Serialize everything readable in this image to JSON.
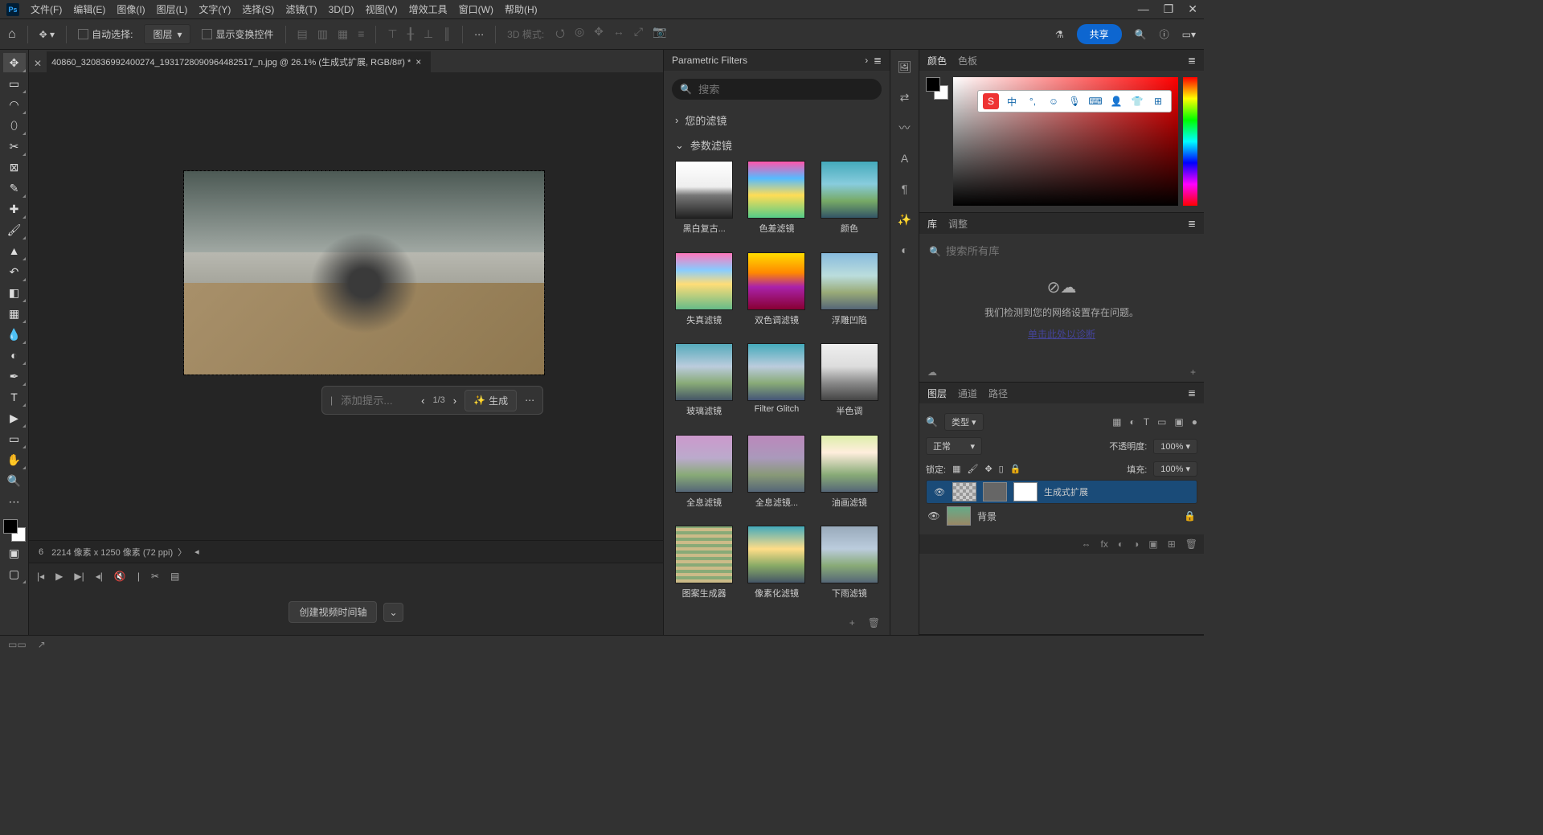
{
  "menu": {
    "items": [
      "文件(F)",
      "编辑(E)",
      "图像(I)",
      "图层(L)",
      "文字(Y)",
      "选择(S)",
      "滤镜(T)",
      "3D(D)",
      "视图(V)",
      "增效工具",
      "窗口(W)",
      "帮助(H)"
    ]
  },
  "optionbar": {
    "auto_select": "自动选择:",
    "dropdown": "图层",
    "show_transform": "显示变换控件",
    "mode_label": "3D 模式:",
    "share": "共享"
  },
  "doctab": "40860_320836992400274_1931728090964482517_n.jpg @ 26.1% (生成式扩展, RGB/8#) *",
  "gen": {
    "placeholder": "添加提示...",
    "count": "1/3",
    "button": "生成"
  },
  "status": {
    "pct": "6",
    "dims": "2214 像素 x 1250 像素 (72 ppi)"
  },
  "timeline": {
    "create": "创建视频时间轴"
  },
  "filters": {
    "title": "Parametric Filters",
    "search_ph": "搜索",
    "your": "您的滤镜",
    "param": "参数滤镜",
    "items": [
      {
        "label": "黑白复古...",
        "g": "linear-gradient(180deg,#fff 0%,#eee 45%,#777 60%,#222 100%)"
      },
      {
        "label": "色差滤镜",
        "g": "linear-gradient(180deg,#f5a 0%,#5bf 30%,#fd5 60%,#5c8 100%)"
      },
      {
        "label": "颜色",
        "g": "linear-gradient(180deg,#4ab 0%,#8cd 40%,#7a6 70%,#356 100%)"
      },
      {
        "label": "失真滤镜",
        "g": "linear-gradient(180deg,#f7b 0%,#8cf 30%,#fd7 55%,#6b8 100%)"
      },
      {
        "label": "双色调滤镜",
        "g": "linear-gradient(180deg,#fd0 0%,#f80 35%,#a2a 60%,#803 100%)"
      },
      {
        "label": "浮雕凹陷",
        "g": "linear-gradient(180deg,#8bd 0%,#bdd 40%,#9a7 70%,#567 100%)"
      },
      {
        "label": "玻璃滤镜",
        "g": "linear-gradient(180deg,#5ab 0%,#bcd 40%,#8a7 70%,#456 100%)"
      },
      {
        "label": "Filter Glitch",
        "g": "linear-gradient(180deg,#4ab 0%,#bcd 40%,#8a7 70%,#457 100%)"
      },
      {
        "label": "半色调",
        "g": "linear-gradient(180deg,#eee 0%,#ddd 40%,#888 70%,#444 100%)"
      },
      {
        "label": "全息滤镜",
        "g": "linear-gradient(180deg,#c9c 0%,#bac 40%,#8a7 70%,#567 100%)"
      },
      {
        "label": "全息滤镜...",
        "g": "linear-gradient(180deg,#b8b 0%,#a9b 40%,#897 70%,#567 100%)"
      },
      {
        "label": "油画滤镜",
        "g": "linear-gradient(180deg,#dea 0%,#fed 30%,#8a7 70%,#567 100%)"
      },
      {
        "label": "图案生成器",
        "g": "repeating-linear-gradient(0deg,#cb8 0 4px,#8a7 4px 8px),repeating-linear-gradient(90deg,#cb8 0 4px,transparent 4px 8px)"
      },
      {
        "label": "像素化滤镜",
        "g": "linear-gradient(180deg,#4ab 0%,#fd8 40%,#8a6 70%,#456 100%)"
      },
      {
        "label": "下雨滤镜",
        "g": "linear-gradient(180deg,#9ab 0%,#bcd 40%,#8a7 70%,#567 100%)"
      }
    ]
  },
  "colorpanel": {
    "tabs": [
      "颜色",
      "色板"
    ]
  },
  "libpanel": {
    "tabs": [
      "库",
      "调整"
    ],
    "search_ph": "搜索所有库",
    "msg": "我们检测到您的网络设置存在问题。",
    "link": "单击此处以诊断"
  },
  "layerspanel": {
    "tabs": [
      "图层",
      "通道",
      "路径"
    ],
    "kind": "类型",
    "blend": "正常",
    "opacity_label": "不透明度:",
    "opacity_val": "100%",
    "lock_label": "锁定:",
    "fill_label": "填充:",
    "fill_val": "100%",
    "layers": [
      {
        "name": "生成式扩展",
        "sel": true,
        "thumbs": [
          "checker",
          "sm",
          "white"
        ]
      },
      {
        "name": "背景",
        "sel": false,
        "locked": true,
        "thumbs": [
          "img"
        ]
      }
    ]
  }
}
